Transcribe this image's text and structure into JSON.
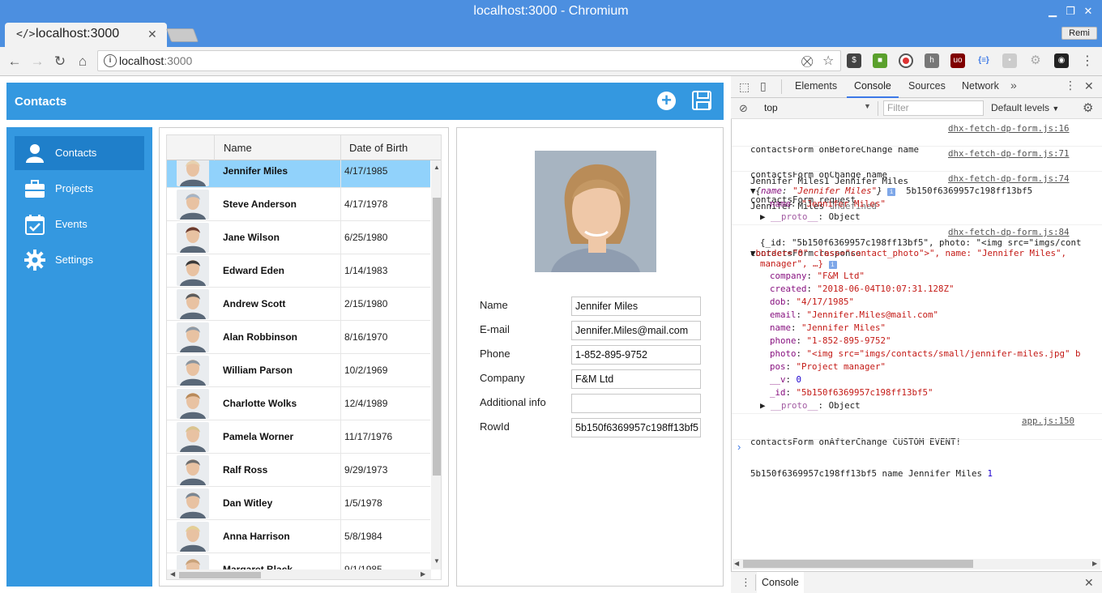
{
  "window": {
    "title": "localhost:3000 - Chromium"
  },
  "tab": {
    "title": "localhost:3000"
  },
  "profile": {
    "label": "Remi"
  },
  "omnibox": {
    "host": "localhost",
    "port": ":3000"
  },
  "app": {
    "title": "Contacts",
    "sidebar": [
      {
        "label": "Contacts",
        "icon": "user-icon",
        "active": true
      },
      {
        "label": "Projects",
        "icon": "briefcase-icon"
      },
      {
        "label": "Events",
        "icon": "calendar-check-icon"
      },
      {
        "label": "Settings",
        "icon": "gear-icon"
      }
    ],
    "grid": {
      "columns": [
        "Name",
        "Date of Birth"
      ],
      "rows": [
        {
          "name": "Jennifer Miles",
          "dob": "4/17/1985",
          "selected": true
        },
        {
          "name": "Steve Anderson",
          "dob": "4/17/1978"
        },
        {
          "name": "Jane Wilson",
          "dob": "6/25/1980"
        },
        {
          "name": "Edward Eden",
          "dob": "1/14/1983"
        },
        {
          "name": "Andrew Scott",
          "dob": "2/15/1980"
        },
        {
          "name": "Alan Robbinson",
          "dob": "8/16/1970"
        },
        {
          "name": "William Parson",
          "dob": "10/2/1969"
        },
        {
          "name": "Charlotte Wolks",
          "dob": "12/4/1989"
        },
        {
          "name": "Pamela Worner",
          "dob": "11/17/1976"
        },
        {
          "name": "Ralf Ross",
          "dob": "9/29/1973"
        },
        {
          "name": "Dan Witley",
          "dob": "1/5/1978"
        },
        {
          "name": "Anna Harrison",
          "dob": "5/8/1984"
        },
        {
          "name": "Margaret Black",
          "dob": "9/1/1985"
        }
      ]
    },
    "form": {
      "fields": [
        {
          "label": "Name",
          "value": "Jennifer Miles"
        },
        {
          "label": "E-mail",
          "value": "Jennifer.Miles@mail.com"
        },
        {
          "label": "Phone",
          "value": "1-852-895-9752"
        },
        {
          "label": "Company",
          "value": "F&M Ltd"
        },
        {
          "label": "Additional info",
          "value": ""
        },
        {
          "label": "RowId",
          "value": "5b150f6369957c198ff13bf5"
        }
      ]
    }
  },
  "devtools": {
    "tabs": [
      "Elements",
      "Console",
      "Sources",
      "Network"
    ],
    "active_tab": "Console",
    "context": "top",
    "filter_placeholder": "Filter",
    "levels": "Default levels",
    "drawer_tab": "Console",
    "messages": {
      "m1_l1": "contactsForm onBeforeChange name",
      "m1_l2": "Jennifer Miles1 Jennifer Miles",
      "m1_src": "dhx-fetch-dp-form.js:16",
      "m2_l1": "contactsForm onChange name",
      "m2_l2a": "Jennifer Miles ",
      "m2_l2b": "undefined",
      "m2_src": "dhx-fetch-dp-form.js:71",
      "m3_l1": "contactsForm request",
      "m3_src": "dhx-fetch-dp-form.js:74",
      "m3_obj_key": "name",
      "m3_obj_val": "\"Jennifer Miles\"",
      "m3_id": "5b150f6369957c198ff13bf5",
      "m3_name_key": "name",
      "m3_name_val": "\"Jennifer Miles\"",
      "m3_proto": "__proto__",
      "m3_proto_val": "Object",
      "m4_l1": "contactsForm response",
      "m4_src": "dhx-fetch-dp-form.js:84",
      "m4_preview1": "{_id: \"5b150f6369957c198ff13bf5\", photo: \"<img src=\"imgs/cont",
      "m4_preview2": "border=\"0\" class=\"contact_photo\">\", name: \"Jennifer Miles\", ",
      "m4_preview3": "manager\", …}",
      "m4_props": [
        {
          "k": "company",
          "v": "\"F&M Ltd\""
        },
        {
          "k": "created",
          "v": "\"2018-06-04T10:07:31.128Z\""
        },
        {
          "k": "dob",
          "v": "\"4/17/1985\""
        },
        {
          "k": "email",
          "v": "\"Jennifer.Miles@mail.com\""
        },
        {
          "k": "name",
          "v": "\"Jennifer Miles\""
        },
        {
          "k": "phone",
          "v": "\"1-852-895-9752\""
        },
        {
          "k": "photo",
          "v": "\"<img src=\"imgs/contacts/small/jennifer-miles.jpg\" b"
        },
        {
          "k": "pos",
          "v": "\"Project manager\""
        },
        {
          "k": "__v",
          "v": "0"
        },
        {
          "k": "_id",
          "v": "\"5b150f6369957c198ff13bf5\""
        }
      ],
      "m4_proto": "__proto__",
      "m4_proto_val": "Object",
      "m5_l1": "contactsForm onAfterChange CUSTOM EVENT!",
      "m5_l2": "5b150f6369957c198ff13bf5 name Jennifer Miles ",
      "m5_l2_num": "1",
      "m5_src": "app.js:150"
    }
  }
}
